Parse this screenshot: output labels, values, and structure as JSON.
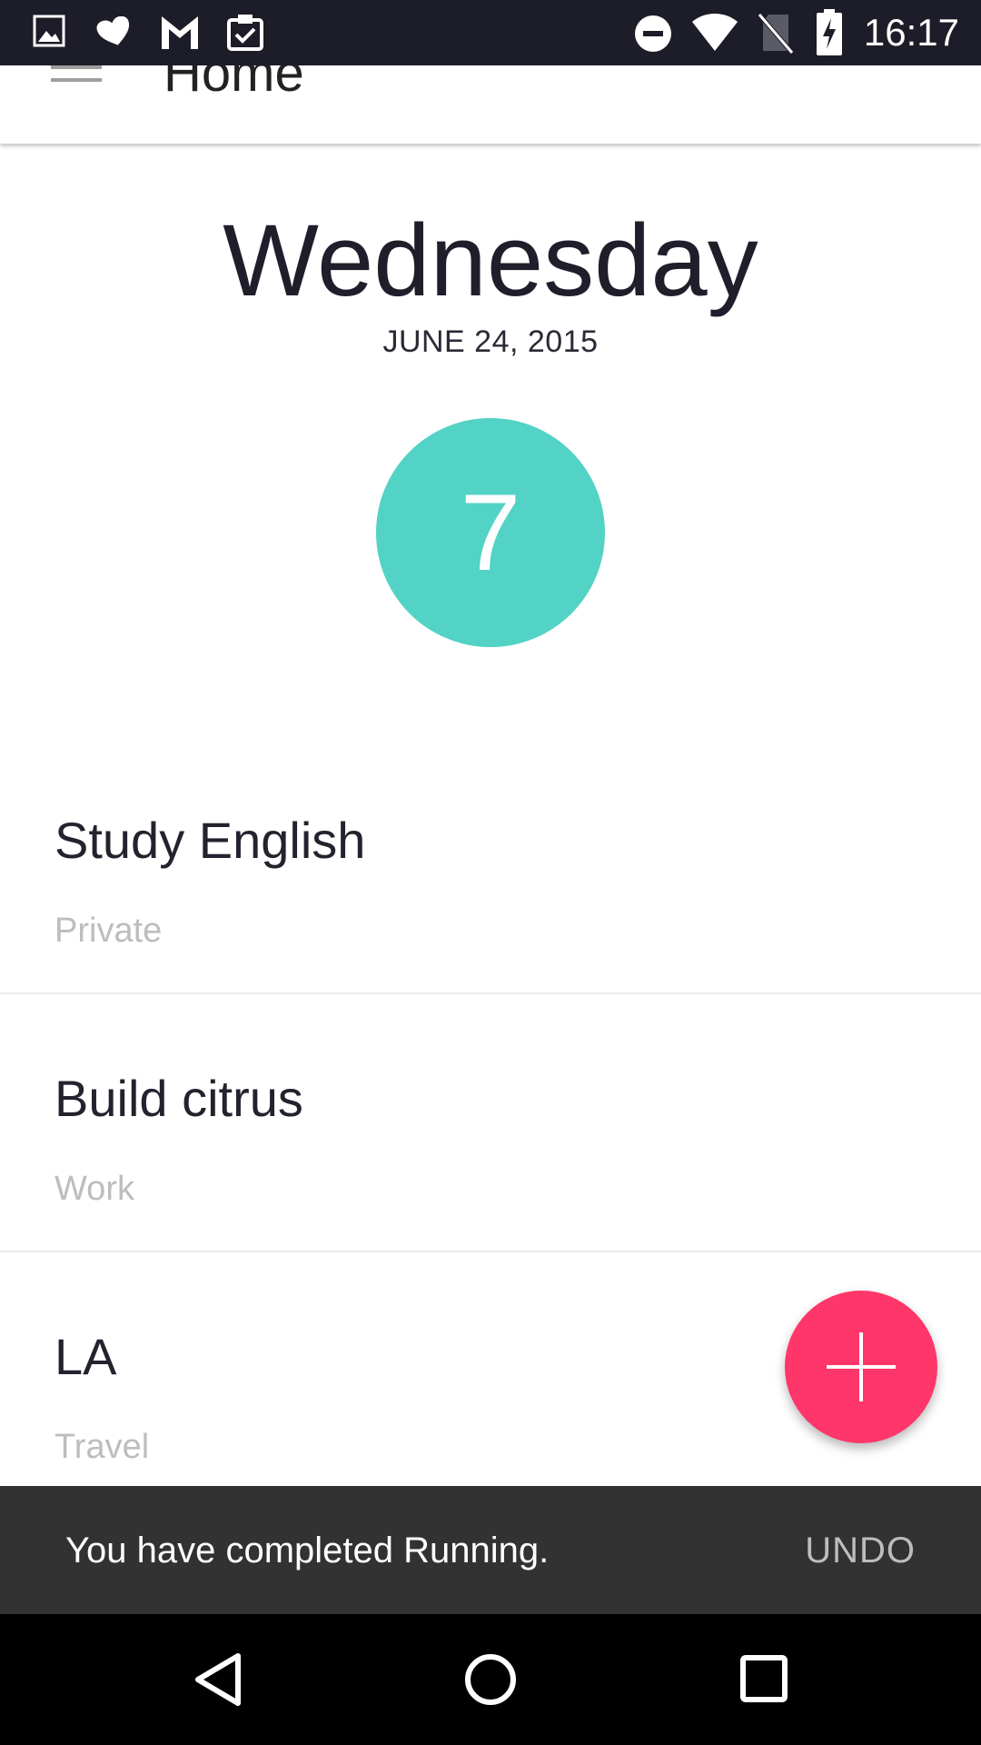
{
  "status_bar": {
    "time": "16:17",
    "icons": [
      "image-icon",
      "heart-icon",
      "gmail-icon",
      "clipboard-check-icon",
      "do-not-disturb-icon",
      "wifi-icon",
      "no-sim-icon",
      "battery-charging-icon"
    ]
  },
  "toolbar": {
    "title": "Home",
    "menu_icon": "menu-icon"
  },
  "header": {
    "day": "Wednesday",
    "date": "JUNE 24, 2015",
    "count": "7",
    "count_color": "#52d3c5"
  },
  "tasks": [
    {
      "title": "Study English",
      "category": "Private"
    },
    {
      "title": "Build citrus",
      "category": "Work"
    },
    {
      "title": "LA",
      "category": "Travel"
    }
  ],
  "fab": {
    "icon": "plus-icon",
    "color": "#ff3669"
  },
  "snackbar": {
    "message": "You have completed Running.",
    "action": "UNDO"
  },
  "nav_bar": {
    "icons": [
      "back-icon",
      "home-icon",
      "recents-icon"
    ]
  }
}
